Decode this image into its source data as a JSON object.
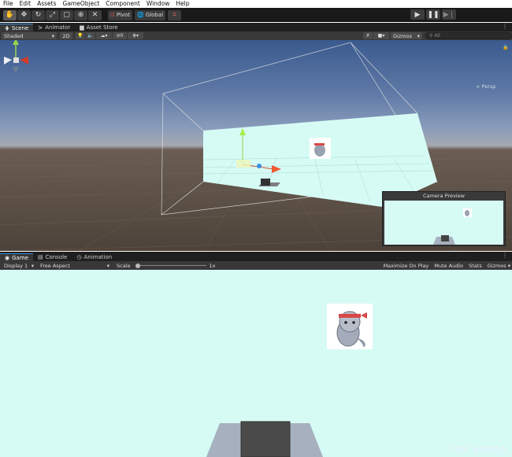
{
  "menu": [
    "File",
    "Edit",
    "Assets",
    "GameObject",
    "Component",
    "Window",
    "Help"
  ],
  "toolbar": {
    "pivot_label": "Pivot",
    "global_label": "Global",
    "tools": [
      "hand-icon",
      "move-icon",
      "rotate-icon",
      "scale-icon",
      "rect-icon",
      "transform-icon",
      "custom-tool-icon"
    ]
  },
  "scene_tabs": [
    {
      "label": "Scene",
      "icon": "grid-icon"
    },
    {
      "label": "Animator",
      "icon": "animator-icon"
    },
    {
      "label": "Asset Store",
      "icon": "store-icon"
    }
  ],
  "scene_bar": {
    "shading_mode": "Shaded",
    "mode_2d": "2D",
    "hidden_count": "0",
    "gizmos_label": "Gizmos",
    "search_placeholder": "All"
  },
  "scene_view": {
    "persp_label": "< Persp",
    "camera_preview_title": "Camera Preview"
  },
  "game_tabs": [
    {
      "label": "Game",
      "icon": "game-icon"
    },
    {
      "label": "Console",
      "icon": "console-icon"
    },
    {
      "label": "Animation",
      "icon": "animation-icon"
    }
  ],
  "game_bar": {
    "display": "Display 1",
    "aspect": "Free Aspect",
    "scale_label": "Scale",
    "scale_value": "1x",
    "maximize_label": "Maximize On Play",
    "mute_label": "Mute Audio",
    "stats_label": "Stats",
    "gizmos_label": "Gizmos"
  },
  "watermark": "CSDN @仓鼠毛吉",
  "colors": {
    "background_color": "#d6fbf5",
    "editor_dark": "#383838",
    "tab_highlight": "#3b8cd3"
  }
}
